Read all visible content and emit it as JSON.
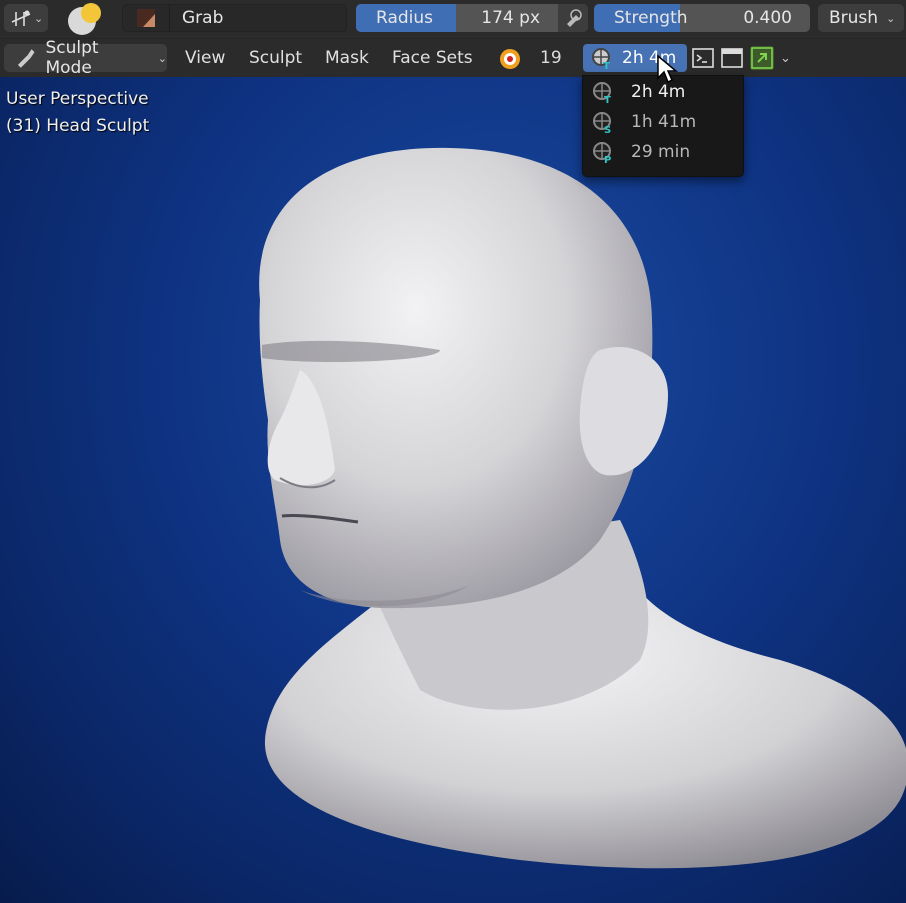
{
  "header": {
    "brush_name": "Grab",
    "radius_label": "Radius",
    "radius_value": "174 px",
    "strength_label": "Strength",
    "strength_value": "0.400",
    "brush_menu": "Brush"
  },
  "header2": {
    "mode": "Sculpt Mode",
    "menus": [
      "View",
      "Sculpt",
      "Mask",
      "Face Sets"
    ],
    "count": "19",
    "time_selected": "2h 4m"
  },
  "dropdown": {
    "items": [
      {
        "label": "2h 4m",
        "badge": "T"
      },
      {
        "label": "1h 41m",
        "badge": "S"
      },
      {
        "label": "29 min",
        "badge": "P"
      }
    ]
  },
  "viewport": {
    "perspective": "User Perspective",
    "object": "(31) Head Sculpt"
  },
  "colors": {
    "accent": "#4772b3",
    "header_bg": "#2b2b2b",
    "viewport_bg": "#0f3484",
    "badge_teal": "#2ec4c4"
  }
}
